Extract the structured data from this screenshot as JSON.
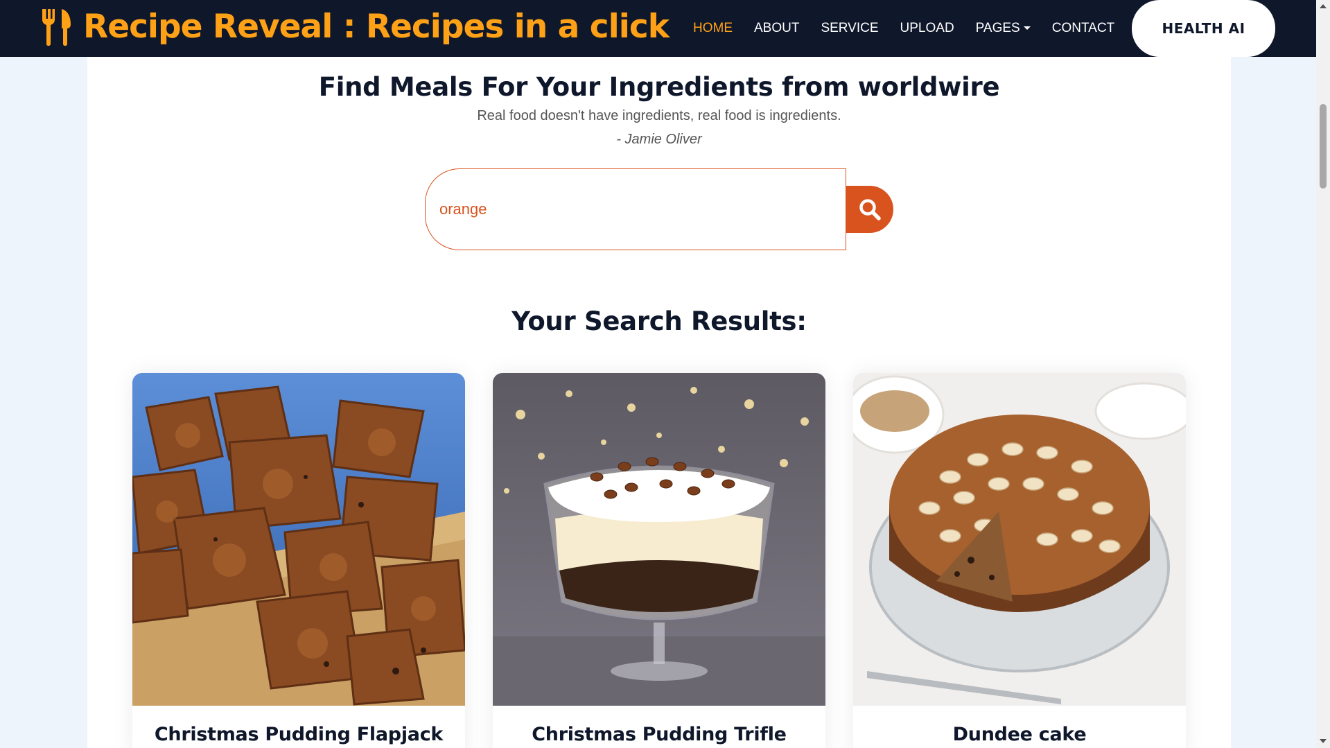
{
  "navbar": {
    "brand": "Recipe Reveal : Recipes in a click",
    "brand_icon": "utensils-icon",
    "links": [
      {
        "label": "HOME",
        "active": true
      },
      {
        "label": "ABOUT",
        "active": false
      },
      {
        "label": "SERVICE",
        "active": false
      },
      {
        "label": "UPLOAD",
        "active": false
      },
      {
        "label": "PAGES",
        "active": false
      },
      {
        "label": "CONTACT",
        "active": false
      }
    ],
    "cta": "HEALTH AI"
  },
  "hero": {
    "title": "Find Meals For Your Ingredients from worldwire",
    "quote": "Real food doesn't have ingredients, real food is ingredients.",
    "author": "- Jamie Oliver"
  },
  "search": {
    "value": "orange",
    "button_icon": "search-icon"
  },
  "results": {
    "heading": "Your Search Results:",
    "cards": [
      {
        "title": "Christmas Pudding Flapjack"
      },
      {
        "title": "Christmas Pudding Trifle"
      },
      {
        "title": "Dundee cake"
      }
    ]
  },
  "colors": {
    "navbar_bg": "#0f172b",
    "brand_accent": "#fea116",
    "search_accent": "#d9531e",
    "page_bg": "#eef4fb"
  }
}
